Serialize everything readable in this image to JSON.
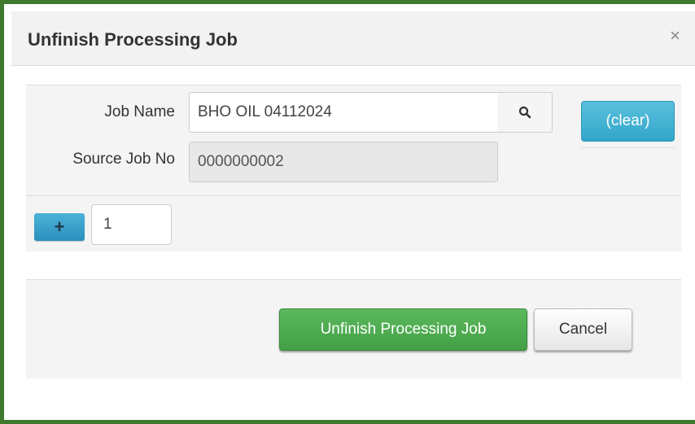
{
  "dialog": {
    "title": "Unfinish Processing Job",
    "close_glyph": "×"
  },
  "form": {
    "job_name_label": "Job Name",
    "job_name_value": "BHO OIL 04112024",
    "source_job_label": "Source Job No",
    "source_job_value": "0000000002",
    "clear_label": "(clear)",
    "plus_glyph": "+",
    "count_value": "1"
  },
  "footer": {
    "primary_label": "Unfinish Processing Job",
    "cancel_label": "Cancel"
  },
  "colors": {
    "frame_border": "#3f7a2c",
    "primary": "#5cb85c",
    "info": "#5bc0de"
  }
}
